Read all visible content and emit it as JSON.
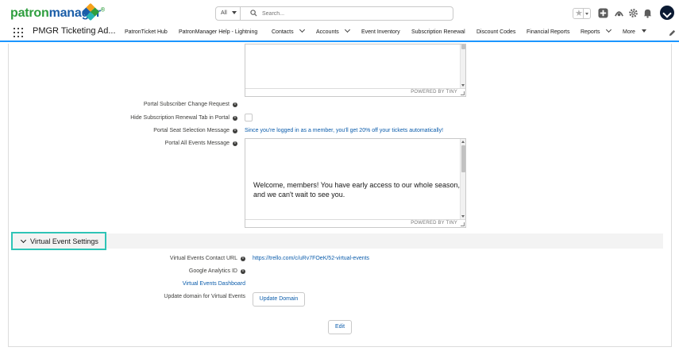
{
  "brand": {
    "logo_part1": "patron",
    "logo_part2": "manager",
    "logo_mark": "®"
  },
  "search": {
    "scope": "All",
    "placeholder": "Search..."
  },
  "header_icons": [
    "star-icon",
    "add-icon",
    "trailhead-icon",
    "setup-gear-icon",
    "notification-bell-icon",
    "avatar"
  ],
  "nav": {
    "app_name": "PMGR Ticketing Ad...",
    "items": [
      {
        "label": "PatronTicket Hub",
        "has_menu": false
      },
      {
        "label": "PatronManager Help - Lightning",
        "has_menu": false
      },
      {
        "label": "Contacts",
        "has_menu": true
      },
      {
        "label": "Accounts",
        "has_menu": true
      },
      {
        "label": "Event Inventory",
        "has_menu": false
      },
      {
        "label": "Subscription Renewal",
        "has_menu": false
      },
      {
        "label": "Discount Codes",
        "has_menu": false
      },
      {
        "label": "Financial Reports",
        "has_menu": false
      },
      {
        "label": "Reports",
        "has_menu": true
      },
      {
        "label": "More",
        "has_menu": true
      }
    ]
  },
  "editor_top": {
    "powered_by": "POWERED BY TINY"
  },
  "fields": {
    "portal_subscriber_change_request": {
      "label": "Portal Subscriber Change Request"
    },
    "hide_subscription_renewal_tab": {
      "label": "Hide Subscription Renewal Tab in Portal",
      "checked": false
    },
    "portal_seat_selection_message": {
      "label": "Portal Seat Selection Message",
      "value": "Since you're logged in as a member, you'll get 20% off your tickets automatically!"
    },
    "portal_all_events_message": {
      "label": "Portal All Events Message",
      "value": "Welcome, members! You have early access to our whole season, and we can't wait to see you.",
      "powered_by": "POWERED BY TINY"
    }
  },
  "virtual_section": {
    "title": "Virtual Event Settings",
    "contact_url_label": "Virtual Events Contact URL",
    "contact_url_value": "https://trello.com/c/uRv7FOeK/52-virtual-events",
    "ga_label": "Google Analytics ID",
    "ga_value": "",
    "dashboard_link": "Virtual Events Dashboard",
    "update_domain_label": "Update domain for Virtual Events",
    "update_domain_button": "Update Domain"
  },
  "edit_button": "Edit",
  "colors": {
    "accent": "#1b96ff",
    "highlight": "#2ec4b6",
    "link": "#0b5cab"
  }
}
